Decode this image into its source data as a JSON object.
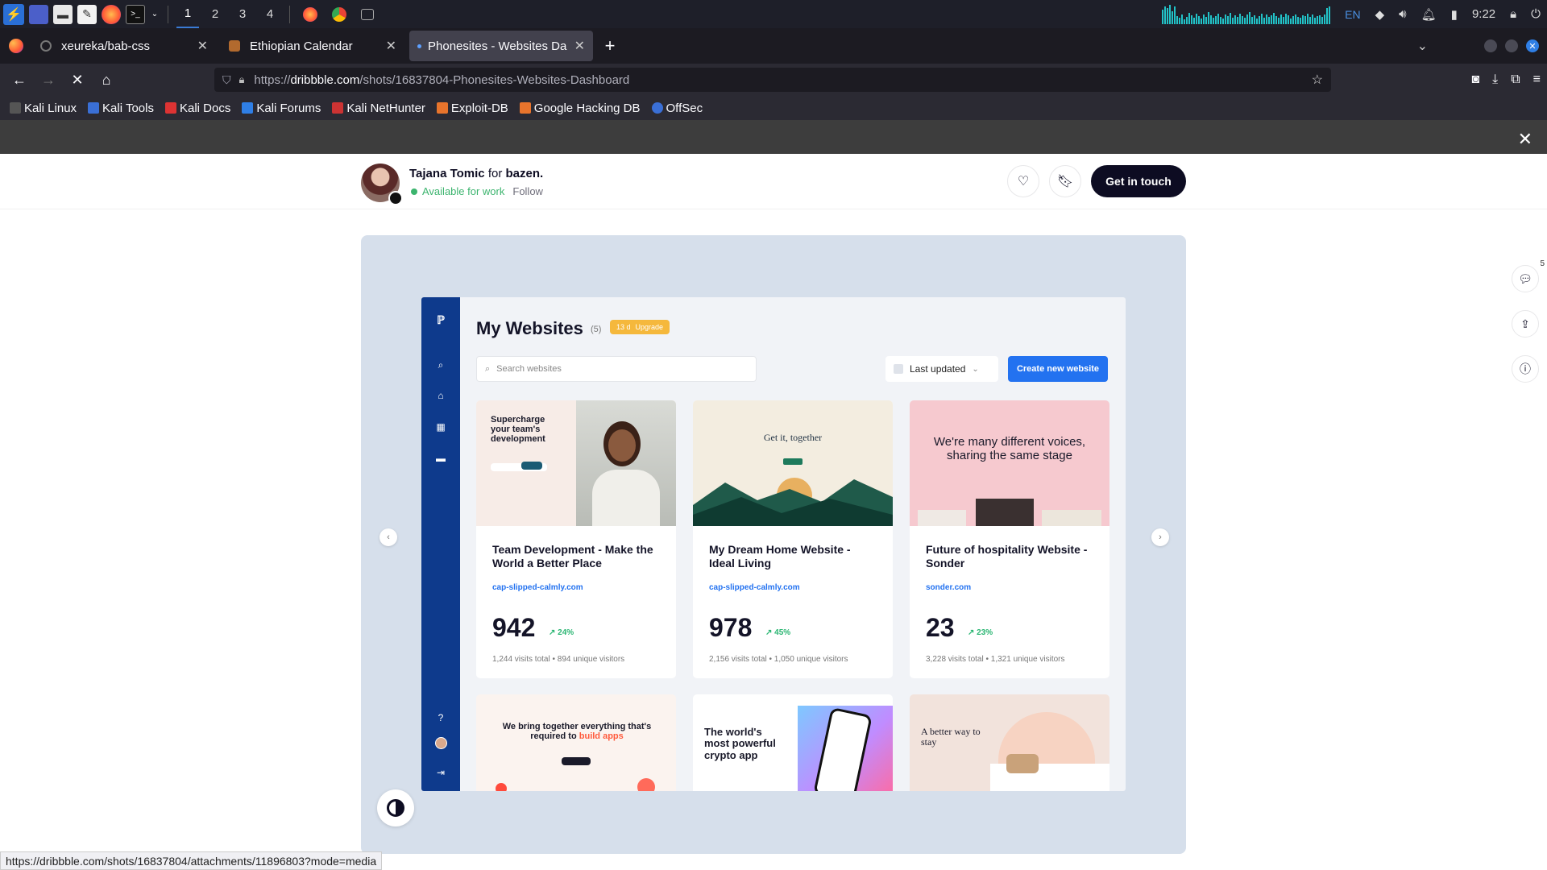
{
  "taskbar": {
    "workspaces": [
      "1",
      "2",
      "3",
      "4"
    ],
    "language": "EN",
    "clock": "9:22"
  },
  "browser": {
    "tabs": [
      {
        "title": "xeureka/bab-css",
        "active": false
      },
      {
        "title": "Ethiopian Calendar",
        "active": false
      },
      {
        "title": "Phonesites - Websites Da",
        "active": true
      }
    ],
    "url": {
      "prefix": "https://",
      "host": "dribbble.com",
      "path": "/shots/16837804-Phonesites-Websites-Dashboard"
    },
    "bookmarks": [
      "Kali Linux",
      "Kali Tools",
      "Kali Docs",
      "Kali Forums",
      "Kali NetHunter",
      "Exploit-DB",
      "Google Hacking DB",
      "OffSec"
    ],
    "status_url": "https://dribbble.com/shots/16837804/attachments/11896803?mode=media"
  },
  "shot": {
    "author": "Tajana Tomic",
    "for_word": "for",
    "team": "bazen.",
    "availability": "Available for work",
    "follow": "Follow",
    "cta": "Get in touch",
    "comments_count": "5"
  },
  "dashboard": {
    "title": "My Websites",
    "count": "(5)",
    "upgrade_days": "13 d",
    "upgrade_label": "Upgrade",
    "search_placeholder": "Search websites",
    "sort_label": "Last updated",
    "create_label": "Create new website",
    "cards": [
      {
        "hero": "Supercharge your team's development",
        "title": "Team Development - Make the World a Better Place",
        "url": "cap-slipped-calmly.com",
        "visits": "942",
        "change": "↗ 24%",
        "stats": "1,244 visits total  •  894 unique visitors"
      },
      {
        "hero": "Get it, together",
        "title": "My Dream Home Website - Ideal Living",
        "url": "cap-slipped-calmly.com",
        "visits": "978",
        "change": "↗ 45%",
        "stats": "2,156 visits total  •  1,050 unique visitors"
      },
      {
        "hero": "We're many different voices, sharing the same stage",
        "title": "Future of hospitality Website - Sonder",
        "url": "sonder.com",
        "visits": "23",
        "change": "↗ 23%",
        "stats": "3,228 visits total  •  1,321 unique visitors"
      }
    ],
    "bottom_cards": [
      {
        "hero": "We bring together everything that's required to",
        "accent": "build apps"
      },
      {
        "hero": "The world's most powerful crypto app"
      },
      {
        "hero": "A better way to stay"
      }
    ]
  },
  "colors": {
    "dribbble_dark": "#0d0c22",
    "available_green": "#3cb46e",
    "dash_blue": "#0e3a8c",
    "accent_blue": "#2372f0",
    "shot_bg": "#d6dfeb"
  }
}
